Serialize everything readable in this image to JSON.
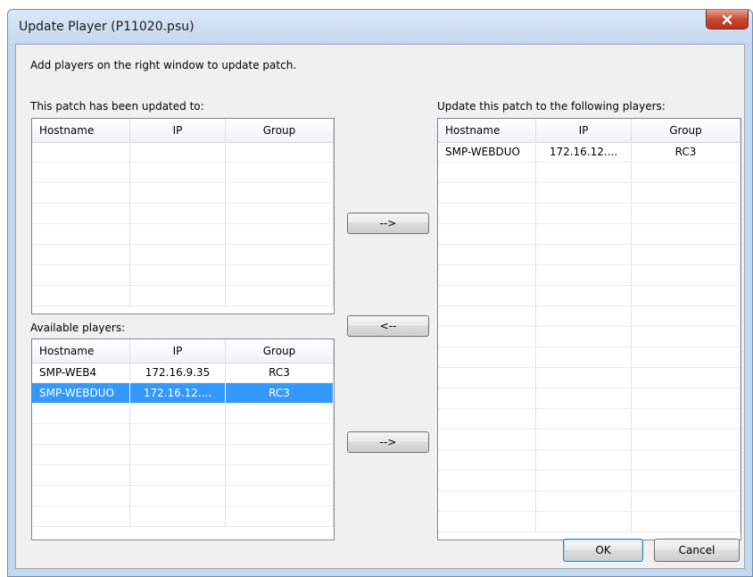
{
  "window": {
    "title": "Update Player (P11020.psu)",
    "close_icon": "close-icon"
  },
  "instruction": "Add players on the right window to update patch.",
  "updated_list": {
    "label": "This patch has been updated to:",
    "columns": [
      "Hostname",
      "IP",
      "Group"
    ],
    "rows": []
  },
  "available_list": {
    "label": "Available players:",
    "columns": [
      "Hostname",
      "IP",
      "Group"
    ],
    "rows": [
      {
        "hostname": "SMP-WEB4",
        "ip": "172.16.9.35",
        "group": "RC3",
        "selected": false
      },
      {
        "hostname": "SMP-WEBDUO",
        "ip": "172.16.12....",
        "group": "RC3",
        "selected": true
      }
    ]
  },
  "target_list": {
    "label": "Update this patch to the following players:",
    "columns": [
      "Hostname",
      "IP",
      "Group"
    ],
    "rows": [
      {
        "hostname": "SMP-WEBDUO",
        "ip": "172.16.12....",
        "group": "RC3",
        "selected": false
      }
    ]
  },
  "buttons": {
    "move_right_top": "-->",
    "move_left": "<--",
    "move_right_bottom": "-->",
    "ok": "OK",
    "cancel": "Cancel"
  },
  "colors": {
    "selection": "#3399ff",
    "frame": "#c4d7ef",
    "close_button": "#c7452c"
  }
}
